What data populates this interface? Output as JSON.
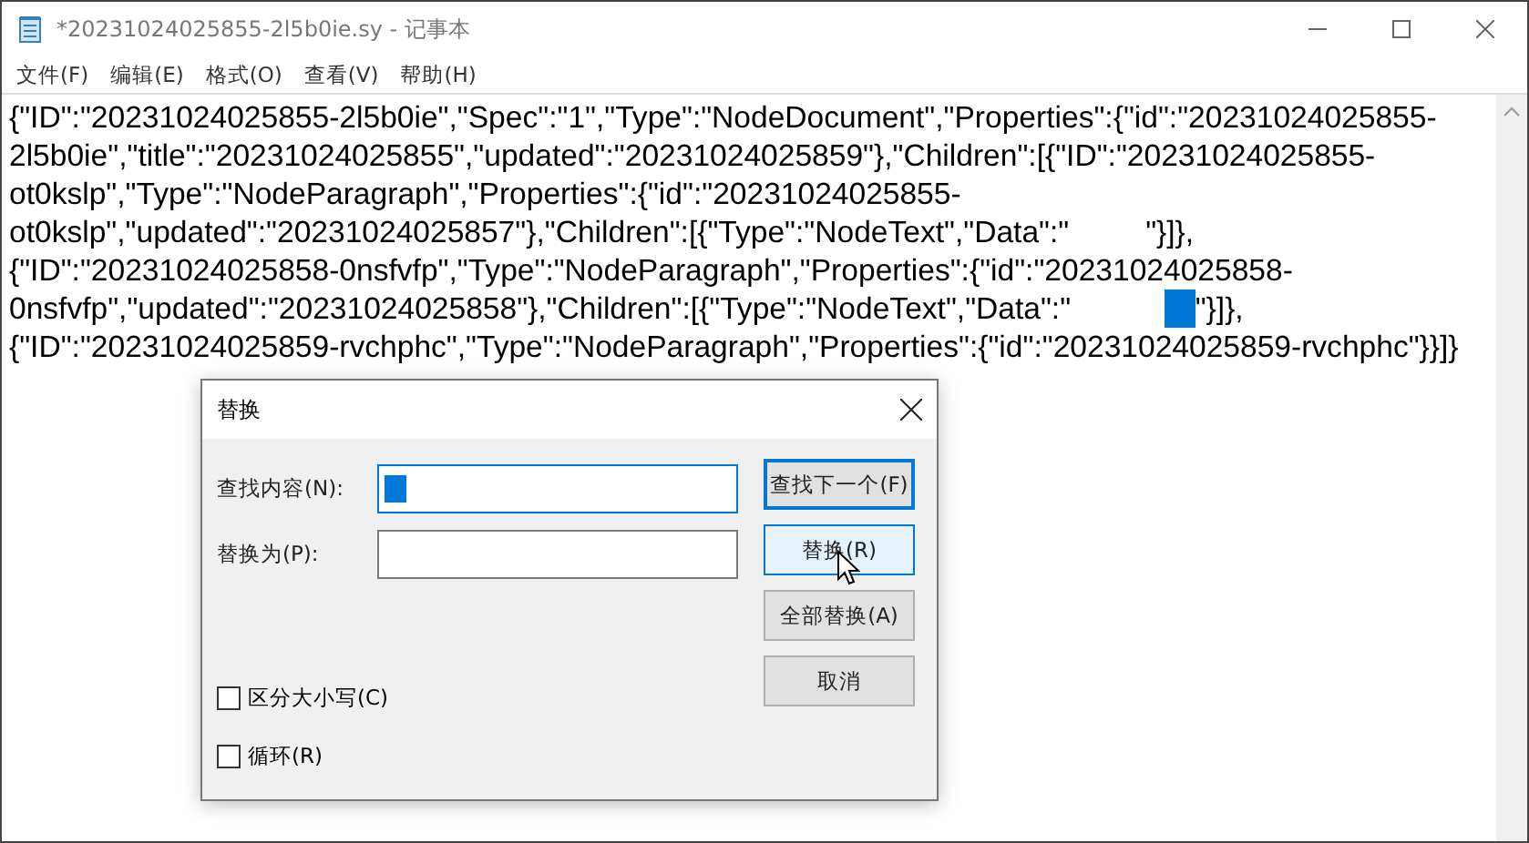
{
  "window": {
    "title": "*20231024025855-2l5b0ie.sy - 记事本"
  },
  "menu": [
    "文件(F)",
    "编辑(E)",
    "格式(O)",
    "查看(V)",
    "帮助(H)"
  ],
  "editor": {
    "lines": [
      {
        "text": "{\"ID\":\"20231024025855-2l5b0ie\",\"Spec\":\"1\",\"Type\":\"NodeDocument\",\"Properties\":{\"id\":\"20231024025855-",
        "selected_blank": false
      },
      {
        "text": "2l5b0ie\",\"title\":\"20231024025855\",\"updated\":\"20231024025859\"},\"Children\":[{\"ID\":\"20231024025855-",
        "selected_blank": false
      },
      {
        "text": "ot0kslp\",\"Type\":\"NodeParagraph\",\"Properties\":{\"id\":\"20231024025855-",
        "selected_blank": false
      },
      {
        "text": "ot0kslp\",\"updated\":\"20231024025857\"},\"Children\":[{\"Type\":\"NodeText\",\"Data\":\"         \"}]},",
        "selected_blank": false
      },
      {
        "text": "{\"ID\":\"20231024025858-0nsfvfp\",\"Type\":\"NodeParagraph\",\"Properties\":{\"id\":\"20231024025858-",
        "selected_blank": false
      },
      {
        "text": "0nsfvfp\",\"updated\":\"20231024025858\"},\"Children\":[{\"Type\":\"NodeText\",\"Data\":\"           ",
        "selected_blank": true,
        "text_after": "\"}]},"
      },
      {
        "text": "{\"ID\":\"20231024025859-rvchphc\",\"Type\":\"NodeParagraph\",\"Properties\":{\"id\":\"20231024025859-rvchphc\"}}]}",
        "selected_blank": false
      }
    ]
  },
  "dialog": {
    "title": "替换",
    "fields": [
      {
        "label": "查找内容(N):",
        "selected_blank": true,
        "focused": true
      },
      {
        "label": "替换为(P):",
        "selected_blank": false,
        "focused": false
      }
    ],
    "buttons": [
      {
        "label": "查找下一个(F)",
        "default": true,
        "hovered": false
      },
      {
        "label": "替换(R)",
        "default": false,
        "hovered": true
      },
      {
        "label": "全部替换(A)",
        "default": false,
        "hovered": false
      },
      {
        "label": "取消",
        "default": false,
        "hovered": false
      }
    ],
    "checkboxes": [
      {
        "label": "区分大小写(C)",
        "checked": false
      },
      {
        "label": "循环(R)",
        "checked": false
      }
    ]
  }
}
